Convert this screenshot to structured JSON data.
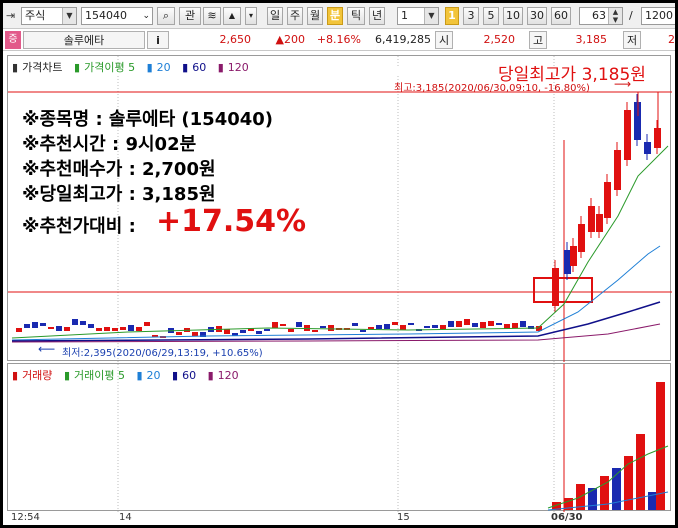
{
  "toolbar": {
    "market_type": "주식",
    "stock_code": "154040",
    "search_icon": "search-icon",
    "link_button": "관",
    "period_buttons": [
      "일",
      "주",
      "월",
      "분",
      "틱",
      "년"
    ],
    "active_period": "분",
    "interval_value": "1",
    "minute_buttons": [
      "1",
      "3",
      "5",
      "10",
      "30",
      "60"
    ],
    "active_minute": "1",
    "count_value": "63",
    "slash": "/",
    "total_value": "1200"
  },
  "quote": {
    "badge": "증",
    "name": "솔루에타",
    "info_button": "i",
    "price": "2,650",
    "change": "▲200",
    "change_pct": "+8.16%",
    "volume": "6,419,285",
    "open_label": "시",
    "open": "2,520",
    "high_label": "고",
    "high": "3,185",
    "low_label": "저",
    "low": "2"
  },
  "price_panel": {
    "legend": [
      {
        "label": "가격차트",
        "color": "#000000"
      },
      {
        "label": "가격이평 5",
        "color": "#2a9a2a"
      },
      {
        "label": "20",
        "color": "#1e7fd6"
      },
      {
        "label": "60",
        "color": "#10108a"
      },
      {
        "label": "120",
        "color": "#8a1a6a"
      }
    ],
    "day_high_title": "당일최고가 3,185원",
    "high_marker": "최고:3,185(2020/06/30,09:10, -16.80%)",
    "low_marker": "최저:2,395(2020/06/29,13:19, +10.65%)",
    "info_lines": [
      "※종목명 : 솔루에타 (154040)",
      "※추천시간 : 9시02분",
      "※추천매수가 : 2,700원",
      "※당일최고가 : 3,185원"
    ],
    "compare_label": "※추천가대비 : ",
    "compare_value": "+17.54%"
  },
  "volume_panel": {
    "legend": [
      {
        "label": "거래량",
        "color": "#000000"
      },
      {
        "label": "거래이평 5",
        "color": "#2a9a2a"
      },
      {
        "label": "20",
        "color": "#1e7fd6"
      },
      {
        "label": "60",
        "color": "#10108a"
      },
      {
        "label": "120",
        "color": "#8a1a6a"
      }
    ]
  },
  "time_axis": {
    "labels": [
      "12:54",
      "14",
      "15",
      "06/30"
    ]
  },
  "colors": {
    "up": "#e01010",
    "down": "#1a2ab0",
    "accent": "#f2c43a"
  }
}
